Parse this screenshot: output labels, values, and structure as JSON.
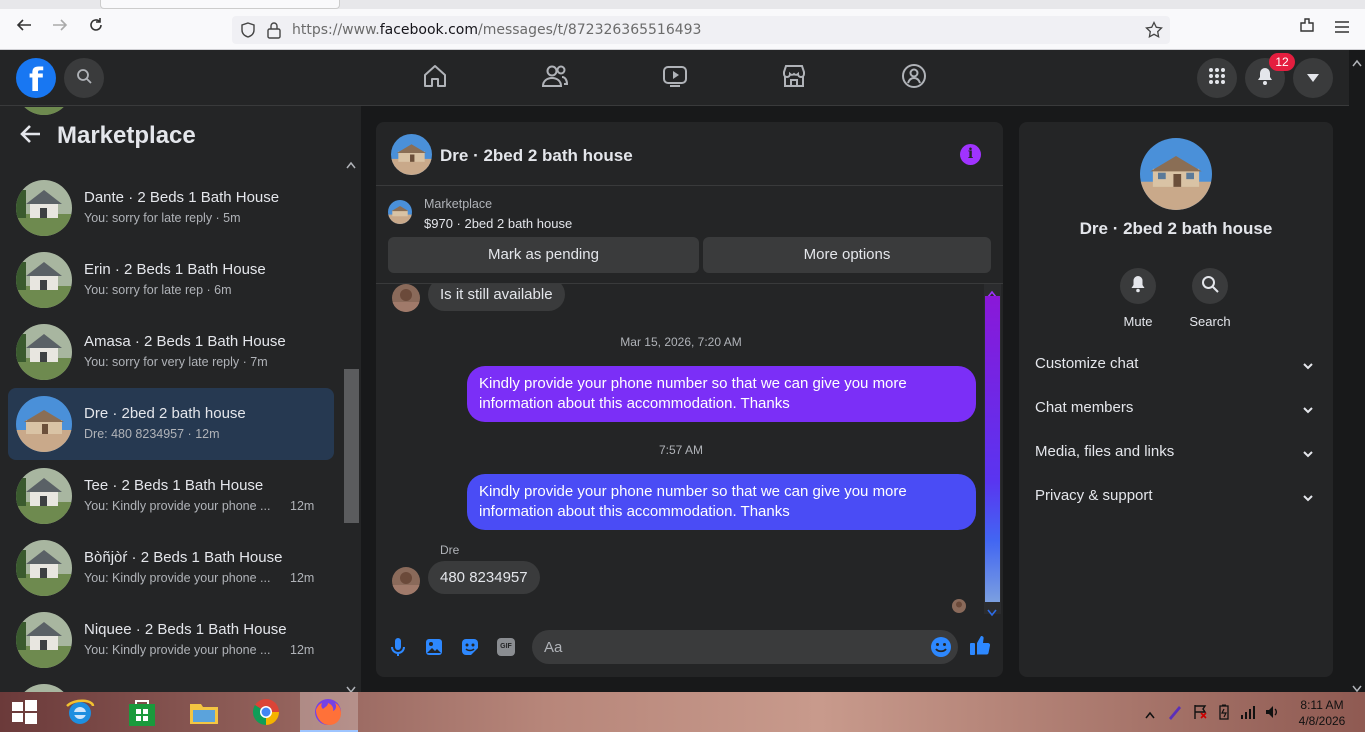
{
  "browser": {
    "url_prefix": "https://www.",
    "url_domain": "facebook.com",
    "url_path": "/messages/t/872326365516493"
  },
  "header": {
    "logo": "f",
    "notification_count": "12"
  },
  "sidebar": {
    "title": "Marketplace",
    "conversations": [
      {
        "name": "Dante · 2 Beds 1 Bath House",
        "preview": "You: sorry for late reply · 5m",
        "time": ""
      },
      {
        "name": "Erin · 2 Beds 1 Bath House",
        "preview": "You: sorry for late rep · 6m",
        "time": ""
      },
      {
        "name": "Amasa · 2 Beds 1 Bath House",
        "preview": "You: sorry for very late reply · 7m",
        "time": ""
      },
      {
        "name": "Dre · 2bed 2 bath house",
        "preview": "Dre: 480 8234957 · 12m",
        "time": ""
      },
      {
        "name": "Tee · 2 Beds 1 Bath House",
        "preview": "You: Kindly provide your phone ...",
        "time": "12m"
      },
      {
        "name": "Bòñjòŕ · 2 Beds 1 Bath House",
        "preview": "You: Kindly provide your phone ...",
        "time": "12m"
      },
      {
        "name": "Niquee · 2 Beds 1 Bath House",
        "preview": "You: Kindly provide your phone ...",
        "time": "12m"
      }
    ]
  },
  "chat": {
    "title": "Dre · 2bed 2 bath house",
    "info_icon": "i",
    "listing_source": "Marketplace",
    "listing_price": "$970 · 2bed 2 bath house",
    "mark_pending": "Mark as pending",
    "more_options": "More options",
    "messages": [
      {
        "text": "Is it still available"
      },
      {
        "timestamp": "Mar 15, 2026, 7:20 AM"
      },
      {
        "text": "Kindly provide your phone number so that we can give you more information about this accommodation. Thanks"
      },
      {
        "timestamp": "7:57 AM"
      },
      {
        "text": "Kindly provide your phone number so that we can give you more information about this accommodation. Thanks"
      },
      {
        "sender": "Dre",
        "text": "480 8234957"
      }
    ],
    "composer_placeholder": "Aa",
    "gif_label": "GIF",
    "accent_purple": "#7b2ff7",
    "accent_blue": "#4a4cf5"
  },
  "right_panel": {
    "name": "Dre · 2bed 2 bath house",
    "mute": "Mute",
    "search": "Search",
    "sections": [
      "Customize chat",
      "Chat members",
      "Media, files and links",
      "Privacy & support"
    ]
  },
  "taskbar": {
    "time": "8:11 AM",
    "date": "4/8/2026"
  }
}
